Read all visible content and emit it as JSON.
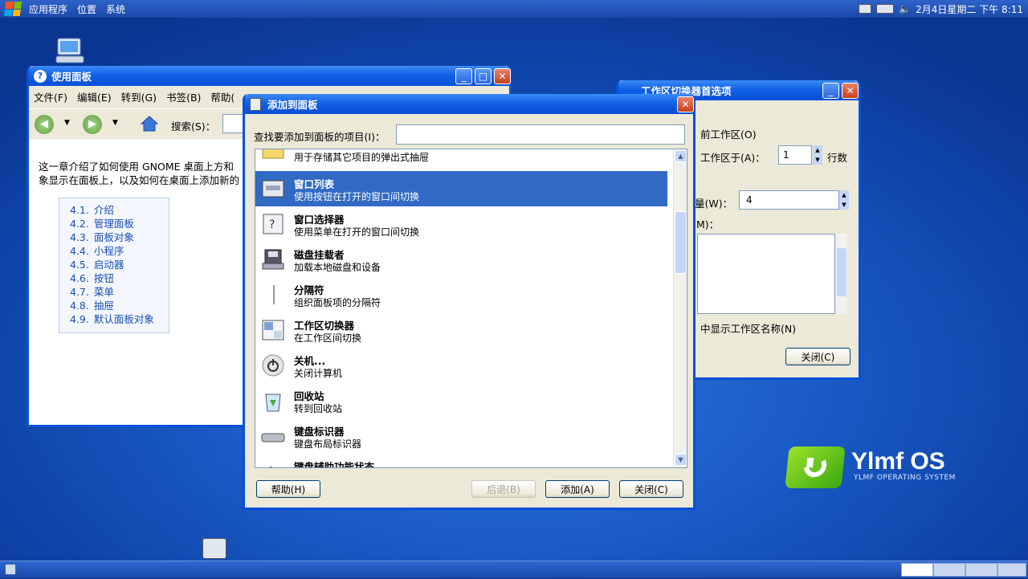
{
  "topbar": {
    "menus": [
      "应用程序",
      "位置",
      "系统"
    ],
    "clock": "2月4日星期二 下午 8:11"
  },
  "desktop": {
    "brand": "Ylmf OS",
    "brand_sub": "YLMF OPERATING SYSTEM"
  },
  "help_window": {
    "title": "使用面板",
    "menu": [
      "文件(F)",
      "编辑(E)",
      "转到(G)",
      "书签(B)",
      "帮助("
    ],
    "search_label": "搜索(S)：",
    "para": "这一章介绍了如何使用 GNOME 桌面上方和\n象显示在面板上，以及如何在桌面上添加新的",
    "toc": [
      {
        "num": "4.1.",
        "label": "介绍"
      },
      {
        "num": "4.2.",
        "label": "管理面板"
      },
      {
        "num": "4.3.",
        "label": "面板对象"
      },
      {
        "num": "4.4.",
        "label": "小程序"
      },
      {
        "num": "4.5.",
        "label": "启动器"
      },
      {
        "num": "4.6.",
        "label": "按钮"
      },
      {
        "num": "4.7.",
        "label": "菜单"
      },
      {
        "num": "4.8.",
        "label": "抽屉"
      },
      {
        "num": "4.9.",
        "label": "默认面板对象"
      }
    ]
  },
  "ws_window": {
    "title": "工作区切换器首选项",
    "current_ws": "前工作区(O)",
    "rows_label": "工作区于(A)：",
    "rows_value": "1",
    "rows_unit": "行数",
    "count_label": "量(W)：",
    "count_value": "4",
    "names_label": "M)：",
    "show_names": "中显示工作区名称(N)",
    "close": "关闭(C)"
  },
  "dialog": {
    "title": "添加到面板",
    "search_label": "查找要添加到面板的项目(I)：",
    "search_value": "",
    "items": [
      {
        "name": "",
        "desc": "用于存储其它项目的弹出式抽屉",
        "icon": "drawer-icon"
      },
      {
        "name": "窗口列表",
        "desc": "使用按钮在打开的窗口间切换",
        "icon": "window-list-icon",
        "selected": true
      },
      {
        "name": "窗口选择器",
        "desc": "使用菜单在打开的窗口间切换",
        "icon": "window-selector-icon"
      },
      {
        "name": "磁盘挂载者",
        "desc": "加载本地磁盘和设备",
        "icon": "disk-mounter-icon"
      },
      {
        "name": "分隔符",
        "desc": "组织面板项的分隔符",
        "icon": "separator-icon"
      },
      {
        "name": "工作区切换器",
        "desc": "在工作区间切换",
        "icon": "workspace-switcher-icon"
      },
      {
        "name": "关机...",
        "desc": "关闭计算机",
        "icon": "power-icon"
      },
      {
        "name": "回收站",
        "desc": "转到回收站",
        "icon": "trash-icon"
      },
      {
        "name": "键盘标识器",
        "desc": "键盘布局标识器",
        "icon": "keyboard-icon"
      },
      {
        "name": "键盘辅助功能状态",
        "desc": "",
        "icon": "accessibility-icon"
      }
    ],
    "buttons": {
      "help": "帮助(H)",
      "back": "后退(B)",
      "add": "添加(A)",
      "close": "关闭(C)"
    }
  }
}
